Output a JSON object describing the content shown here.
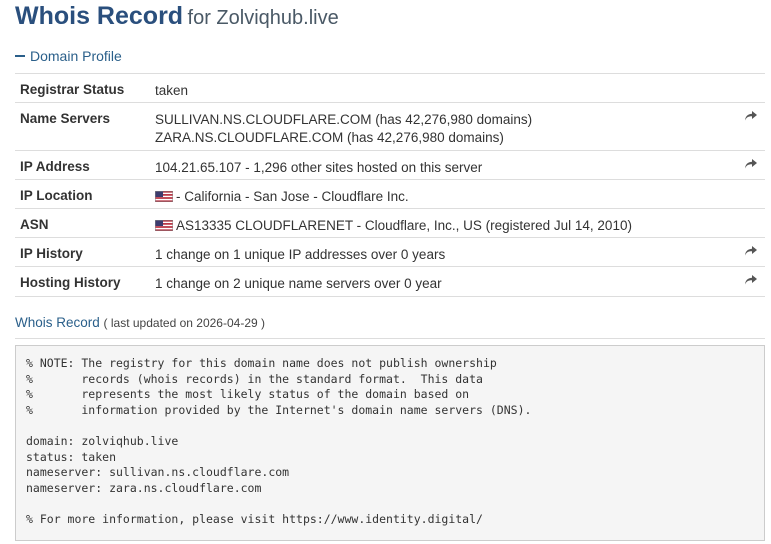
{
  "header": {
    "title": "Whois Record",
    "subtitle": "for Zolviqhub.live"
  },
  "profile": {
    "section_title": "Domain Profile",
    "rows": [
      {
        "label": "Registrar Status",
        "lines": [
          "taken"
        ],
        "has_action": false
      },
      {
        "label": "Name Servers",
        "lines": [
          "SULLIVAN.NS.CLOUDFLARE.COM (has 42,276,980 domains)",
          "ZARA.NS.CLOUDFLARE.COM (has 42,276,980 domains)"
        ],
        "has_action": true
      },
      {
        "label": "IP Address",
        "lines": [
          "104.21.65.107 - 1,296 other sites hosted on this server"
        ],
        "has_action": true
      },
      {
        "label": "IP Location",
        "lines": [
          "- California - San Jose - Cloudflare Inc."
        ],
        "flag": true,
        "has_action": false
      },
      {
        "label": "ASN",
        "lines": [
          "AS13335 CLOUDFLARENET - Cloudflare, Inc., US (registered Jul 14, 2010)"
        ],
        "flag": true,
        "has_action": false
      },
      {
        "label": "IP History",
        "lines": [
          "1 change on 1 unique IP addresses over 0 years"
        ],
        "has_action": true
      },
      {
        "label": "Hosting History",
        "lines": [
          "1 change on 2 unique name servers over 0 year"
        ],
        "has_action": true
      }
    ]
  },
  "whois": {
    "title": "Whois Record",
    "updated": "( last updated on 2026-04-29 )",
    "raw": [
      "% NOTE: The registry for this domain name does not publish ownership",
      "%       records (whois records) in the standard format.  This data",
      "%       represents the most likely status of the domain based on",
      "%       information provided by the Internet's domain name servers (DNS).",
      "",
      "domain: zolviqhub.live",
      "status: taken",
      "nameserver: sullivan.ns.cloudflare.com",
      "nameserver: zara.ns.cloudflare.com",
      "",
      "% For more information, please visit https://www.identity.digital/"
    ]
  },
  "colors": {
    "title": "#2a4f7d",
    "link": "#2a5f8a",
    "border": "#dddddd",
    "raw_background": "#f5f5f5"
  },
  "icons": {
    "section_toggle": "minus-icon",
    "row_action": "share-arrow-icon",
    "location_flag": "us-flag-icon"
  }
}
